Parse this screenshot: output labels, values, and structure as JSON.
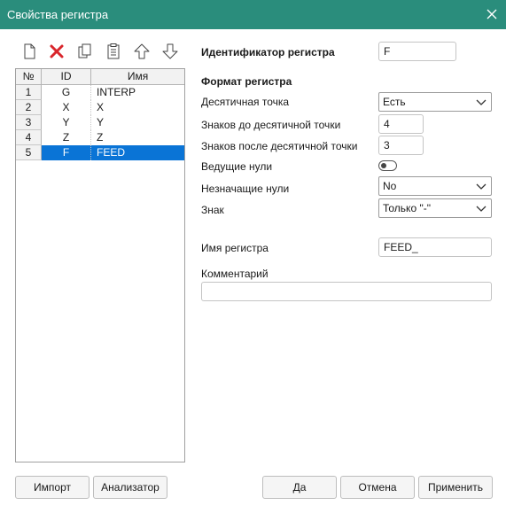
{
  "window": {
    "title": "Свойства регистра"
  },
  "toolbar": {
    "icons": [
      "new-icon",
      "delete-icon",
      "copy-icon",
      "paste-icon",
      "move-up-icon",
      "move-down-icon"
    ]
  },
  "table": {
    "headers": [
      "№",
      "ID",
      "Имя"
    ],
    "rows": [
      {
        "num": "1",
        "id": "G",
        "name": "INTERP"
      },
      {
        "num": "2",
        "id": "X",
        "name": "X"
      },
      {
        "num": "3",
        "id": "Y",
        "name": "Y"
      },
      {
        "num": "4",
        "id": "Z",
        "name": "Z"
      },
      {
        "num": "5",
        "id": "F",
        "name": "FEED"
      }
    ],
    "selected_row": 5
  },
  "form": {
    "register_id_label": "Идентификатор регистра",
    "register_id_value": "F",
    "format_heading": "Формат регистра",
    "decimal_point_label": "Десятичная точка",
    "decimal_point_value": "Есть",
    "digits_before_label": "Знаков до десятичной точки",
    "digits_before_value": "4",
    "digits_after_label": "Знаков после десятичной точки",
    "digits_after_value": "3",
    "leading_zeros_label": "Ведущие нули",
    "leading_zeros_on": false,
    "trailing_zeros_label": "Незначащие нули",
    "trailing_zeros_value": "No",
    "sign_label": "Знак",
    "sign_value": "Только \"-\"",
    "register_name_label": "Имя регистра",
    "register_name_value": "FEED_",
    "comment_label": "Комментарий",
    "comment_value": ""
  },
  "buttons": {
    "import": "Импорт",
    "analyzer": "Анализатор",
    "ok": "Да",
    "cancel": "Отмена",
    "apply": "Применить"
  },
  "colors": {
    "titlebar": "#2a8d7c",
    "selection": "#0a74d6",
    "delete_red": "#d9262c"
  }
}
